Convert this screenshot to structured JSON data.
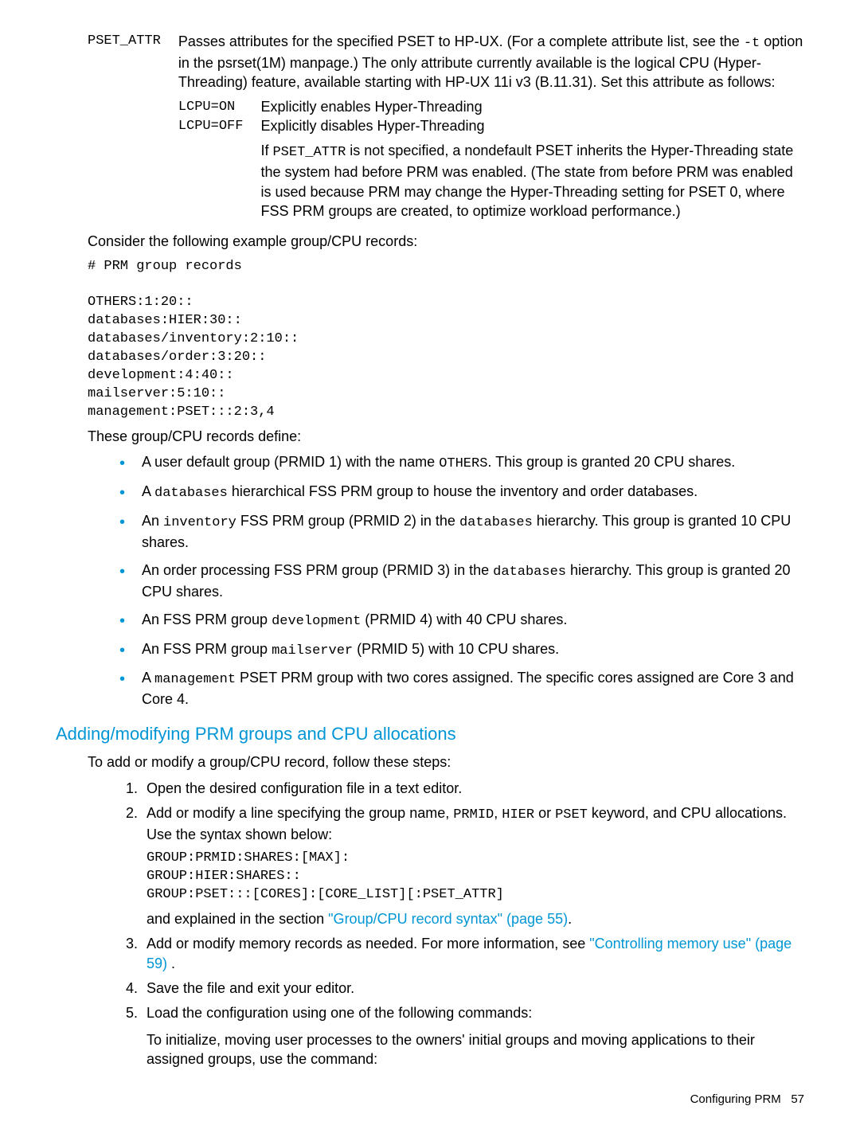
{
  "def": {
    "term": "PSET_ATTR",
    "body_1a": "Passes attributes for the specified PSET to HP-UX. (For a complete attribute list, see the ",
    "body_1_mono": "-t",
    "body_1b": " option in the psrset(1M) manpage.) The only attribute currently available is the logical CPU (Hyper-Threading) feature, available starting with HP-UX 11i v3 (B.11.31). Set this attribute as follows:",
    "sub1_term": "LCPU=ON",
    "sub1_body": "Explicitly enables Hyper-Threading",
    "sub2_term": "LCPU=OFF",
    "sub2_body": "Explicitly disables Hyper-Threading",
    "sub2_body2a": "If ",
    "sub2_body2_mono": "PSET_ATTR",
    "sub2_body2b": " is not specified, a nondefault PSET inherits the Hyper-Threading state the system had before PRM was enabled. (The state from before PRM was enabled is used because PRM may change the Hyper-Threading setting for PSET 0, where FSS PRM groups are created, to optimize workload performance.)"
  },
  "para_consider": "Consider the following example group/CPU records:",
  "code1": "# PRM group records\n\nOTHERS:1:20::\ndatabases:HIER:30::\ndatabases/inventory:2:10::\ndatabases/order:3:20::\ndevelopment:4:40::\nmailserver:5:10::\nmanagement:PSET:::2:3,4",
  "para_these": "These group/CPU records define:",
  "b1a": "A user default group (PRMID 1) with the name ",
  "b1_mono": "OTHERS",
  "b1b": ". This group is granted 20 CPU shares.",
  "b2a": "A ",
  "b2_mono": "databases",
  "b2b": " hierarchical FSS PRM group to house the inventory and order databases.",
  "b3a": "An ",
  "b3_mono1": "inventory",
  "b3b": " FSS PRM group (PRMID 2) in the ",
  "b3_mono2": "databases",
  "b3c": " hierarchy. This group is granted 10 CPU shares.",
  "b4a": "An order processing FSS PRM group (PRMID 3) in the ",
  "b4_mono": "databases",
  "b4b": " hierarchy. This group is granted 20 CPU shares.",
  "b5a": "An FSS PRM group ",
  "b5_mono": "development",
  "b5b": " (PRMID 4) with 40 CPU shares.",
  "b6a": "An FSS PRM group ",
  "b6_mono": "mailserver",
  "b6b": " (PRMID 5) with 10 CPU shares.",
  "b7a": "A ",
  "b7_mono": "management",
  "b7b": " PSET PRM group with two cores assigned. The specific cores assigned are Core 3 and Core 4.",
  "section_title": "Adding/modifying PRM groups and CPU allocations",
  "para_add": "To add or modify a group/CPU record, follow these steps:",
  "step1": "Open the desired configuration file in a text editor.",
  "step2a": "Add or modify a line specifying the group name, ",
  "step2_m1": "PRMID",
  "step2b": ", ",
  "step2_m2": "HIER",
  "step2c": " or ",
  "step2_m3": "PSET",
  "step2d": " keyword, and CPU allocations. Use the syntax shown below:",
  "code2": "GROUP:PRMID:SHARES:[MAX]:\nGROUP:HIER:SHARES::\nGROUP:PSET:::[CORES]:[CORE_LIST][:PSET_ATTR]",
  "step2_expl_a": "and explained in the section ",
  "step2_link": "\"Group/CPU record syntax\" (page 55)",
  "step2_expl_b": ".",
  "step3a": "Add or modify memory records as needed. For more information, see ",
  "step3_link": "\"Controlling memory use\" (page 59)",
  "step3b": " .",
  "step4": "Save the file and exit your editor.",
  "step5": "Load the configuration using one of the following commands:",
  "step5_para": "To initialize, moving user processes to the owners' initial groups and moving applications to their assigned groups, use the command:",
  "footer_a": "Configuring PRM",
  "footer_b": "57"
}
